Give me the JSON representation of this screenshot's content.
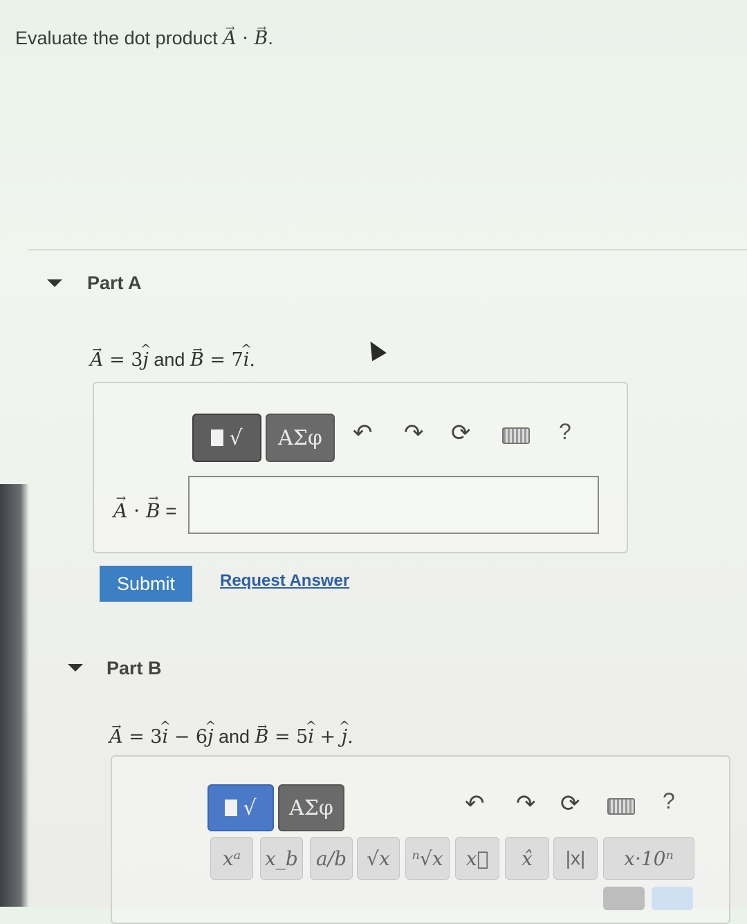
{
  "intro": {
    "text": "Evaluate the dot product",
    "expr_a": "A",
    "dot": " · ",
    "expr_b": "B",
    "end": "."
  },
  "part_a": {
    "title": "Part A",
    "given": {
      "a_sym": "A",
      "a_eq": " = 3",
      "a_unit": "j",
      "and": " and ",
      "b_sym": "B",
      "b_eq": " = 7",
      "b_unit": "i",
      "end": "."
    },
    "toolbar": {
      "template": "√",
      "greek": "ΑΣφ",
      "undo": "↶",
      "redo": "↷",
      "reset": "⟳",
      "help": "?"
    },
    "input_label": {
      "a": "A",
      "dot": " · ",
      "b": "B",
      "eq": " ="
    },
    "input_value": "",
    "submit_label": "Submit",
    "request_label": "Request Answer"
  },
  "part_b": {
    "title": "Part B",
    "given": {
      "a_sym": "A",
      "a_eq": " = 3",
      "i1": "i",
      "minus": " − 6",
      "j1": "j",
      "and": " and ",
      "b_sym": "B",
      "b_eq": " = 5",
      "i2": "i",
      "plus": " + ",
      "j2": "j",
      "end": "."
    },
    "toolbar": {
      "template": "√",
      "greek": "ΑΣφ",
      "undo": "↶",
      "redo": "↷",
      "reset": "⟳",
      "help": "?"
    },
    "templates": [
      "xᵃ",
      "x_b",
      "a/b",
      "√x",
      "ⁿ√x",
      "x⃗",
      "x̂",
      "|x|",
      "x·10ⁿ"
    ]
  },
  "icons": [
    "template-icon",
    "undo-icon",
    "redo-icon",
    "reset-icon",
    "keyboard-icon",
    "help-icon",
    "collapse-triangle-icon",
    "mouse-cursor-icon"
  ]
}
